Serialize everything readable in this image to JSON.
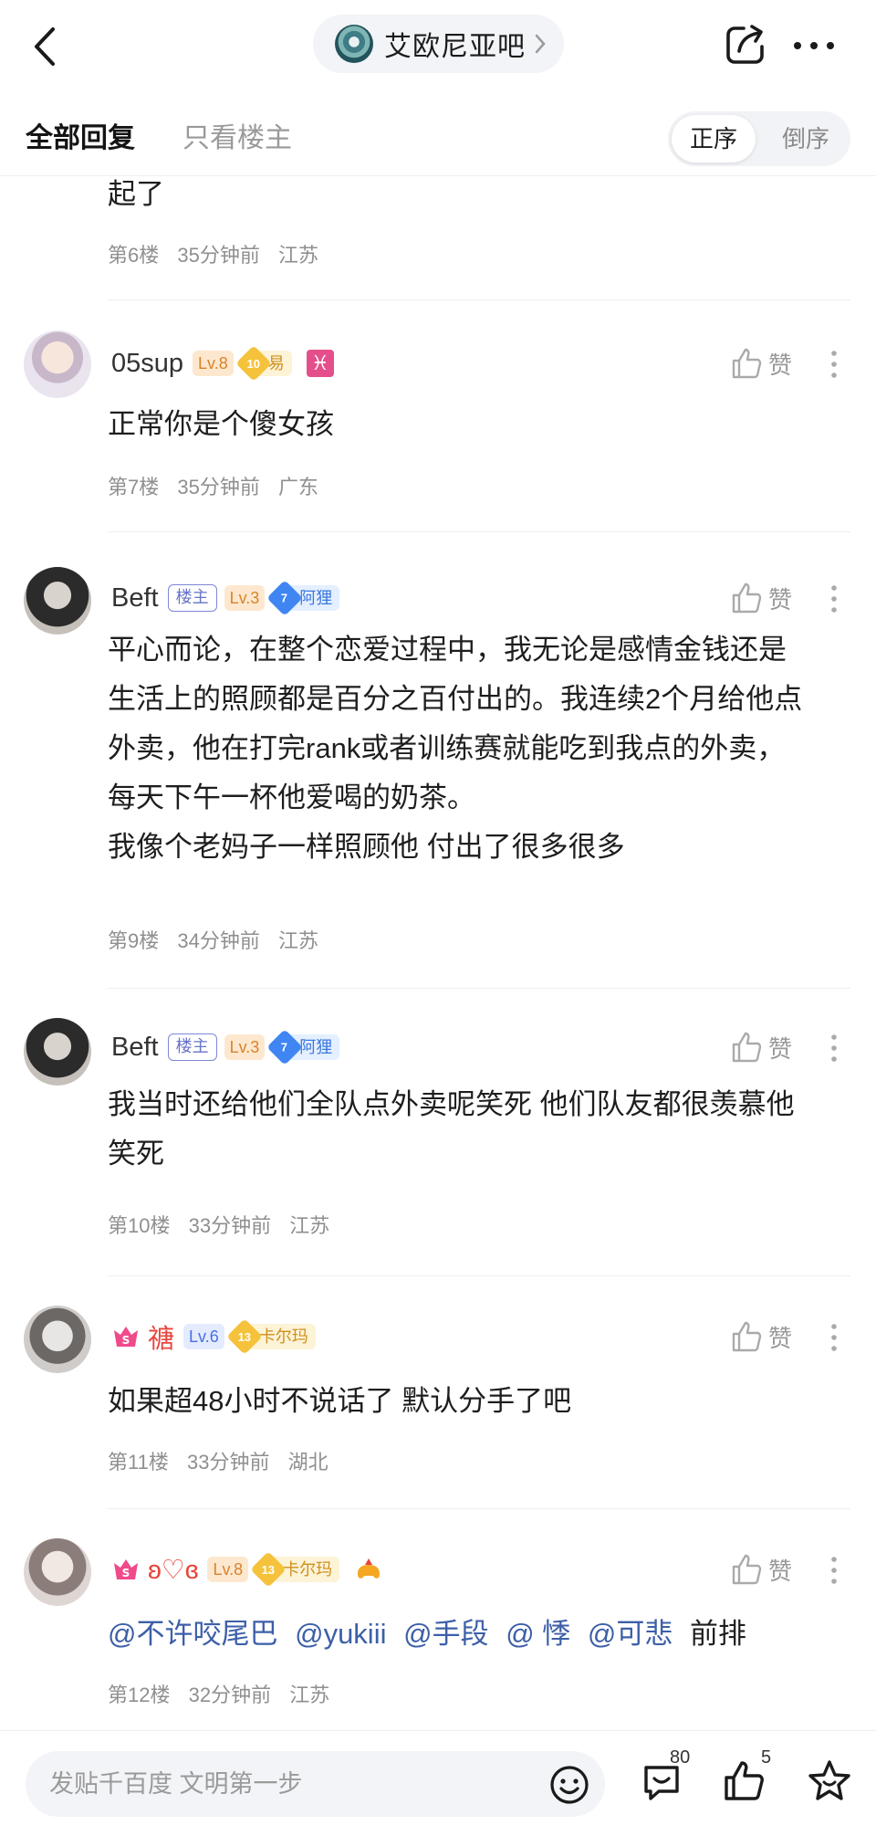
{
  "header": {
    "forum_name": "艾欧尼亚吧"
  },
  "tabs": {
    "all_replies": "全部回复",
    "owner_only": "只看楼主",
    "order_asc": "正序",
    "order_desc": "倒序"
  },
  "posts": [
    {
      "content": "起了",
      "floor": "第6楼",
      "time": "35分钟前",
      "location": "江苏"
    },
    {
      "username": "05sup",
      "level": "Lv.8",
      "gem_number": "10",
      "gem_label": "易",
      "zodiac": "♓",
      "like_label": "赞",
      "content": "正常你是个傻女孩",
      "floor": "第7楼",
      "time": "35分钟前",
      "location": "广东"
    },
    {
      "username": "Beft",
      "owner_badge": "楼主",
      "level": "Lv.3",
      "gem_number": "7",
      "gem_label": "阿狸",
      "like_label": "赞",
      "content_lines": [
        "平心而论，在整个恋爱过程中，我无论是感情金钱还是",
        "生活上的照顾都是百分之百付出的。我连续2个月给他点",
        "外卖，他在打完rank或者训练赛就能吃到我点的外卖，",
        "每天下午一杯他爱喝的奶茶。",
        "我像个老妈子一样照顾他 付出了很多很多"
      ],
      "floor": "第9楼",
      "time": "34分钟前",
      "location": "江苏"
    },
    {
      "username": "Beft",
      "owner_badge": "楼主",
      "level": "Lv.3",
      "gem_number": "7",
      "gem_label": "阿狸",
      "like_label": "赞",
      "content_lines": [
        "我当时还给他们全队点外卖呢笑死 他们队友都很羡慕他",
        "笑死"
      ],
      "floor": "第10楼",
      "time": "33分钟前",
      "location": "江苏"
    },
    {
      "username": "禟",
      "level": "Lv.6",
      "gem_number": "13",
      "gem_label": "卡尔玛",
      "like_label": "赞",
      "content": "如果超48小时不说话了 默认分手了吧",
      "floor": "第11楼",
      "time": "33分钟前",
      "location": "湖北"
    },
    {
      "username": "ʚ♡ɞ",
      "level": "Lv.8",
      "gem_number": "13",
      "gem_label": "卡尔玛",
      "like_label": "赞",
      "mentions": [
        "@不许咬尾巴",
        "@yukiii",
        "@手段",
        "@ 悸",
        "@可悲"
      ],
      "content_tail": "前排",
      "floor": "第12楼",
      "time": "32分钟前",
      "location": "江苏"
    }
  ],
  "bottom_bar": {
    "input_placeholder": "发贴千百度 文明第一步",
    "comment_count": "80",
    "like_count": "5"
  },
  "colors": {
    "accent_red": "#e8453c",
    "mention_blue": "#3d5fa8",
    "level_orange": "#d9822b",
    "level_blue": "#4a6fe0"
  }
}
